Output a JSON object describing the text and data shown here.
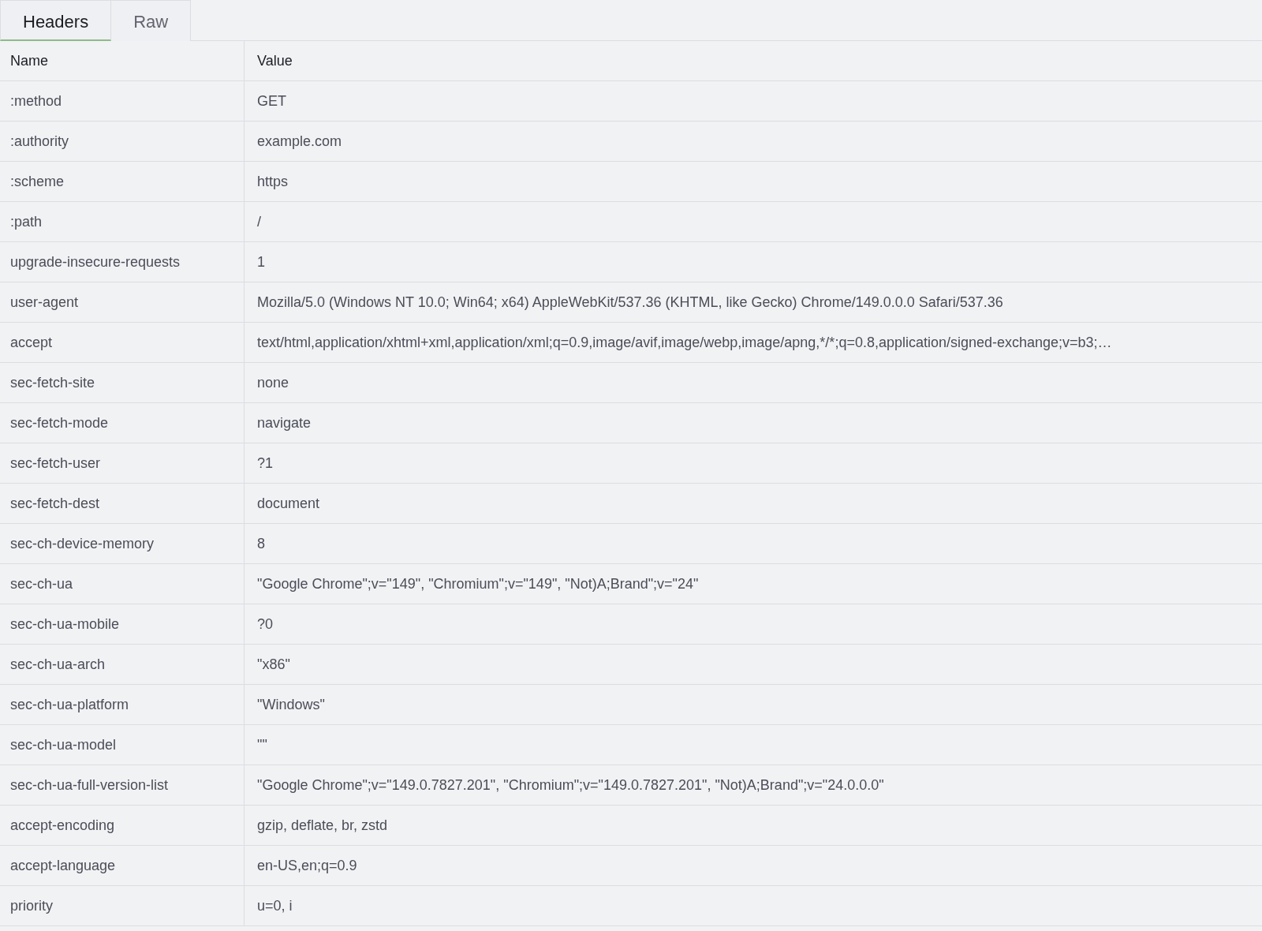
{
  "tabs": [
    {
      "label": "Headers",
      "selected": true
    },
    {
      "label": "Raw",
      "selected": false
    }
  ],
  "table": {
    "columns": [
      "Name",
      "Value"
    ],
    "rows": [
      {
        "name": ":method",
        "value": "GET"
      },
      {
        "name": ":authority",
        "value": "example.com"
      },
      {
        "name": ":scheme",
        "value": "https"
      },
      {
        "name": ":path",
        "value": "/"
      },
      {
        "name": "upgrade-insecure-requests",
        "value": "1"
      },
      {
        "name": "user-agent",
        "value": "Mozilla/5.0 (Windows NT 10.0; Win64; x64) AppleWebKit/537.36 (KHTML, like Gecko) Chrome/149.0.0.0 Safari/537.36"
      },
      {
        "name": "accept",
        "value": "text/html,application/xhtml+xml,application/xml;q=0.9,image/avif,image/webp,image/apng,*/*;q=0.8,application/signed-exchange;v=b3;…"
      },
      {
        "name": "sec-fetch-site",
        "value": "none"
      },
      {
        "name": "sec-fetch-mode",
        "value": "navigate"
      },
      {
        "name": "sec-fetch-user",
        "value": "?1"
      },
      {
        "name": "sec-fetch-dest",
        "value": "document"
      },
      {
        "name": "sec-ch-device-memory",
        "value": "8"
      },
      {
        "name": "sec-ch-ua",
        "value": "\"Google Chrome\";v=\"149\", \"Chromium\";v=\"149\", \"Not)A;Brand\";v=\"24\""
      },
      {
        "name": "sec-ch-ua-mobile",
        "value": "?0"
      },
      {
        "name": "sec-ch-ua-arch",
        "value": "\"x86\""
      },
      {
        "name": "sec-ch-ua-platform",
        "value": "\"Windows\""
      },
      {
        "name": "sec-ch-ua-model",
        "value": "\"\""
      },
      {
        "name": "sec-ch-ua-full-version-list",
        "value": "\"Google Chrome\";v=\"149.0.7827.201\", \"Chromium\";v=\"149.0.7827.201\", \"Not)A;Brand\";v=\"24.0.0.0\""
      },
      {
        "name": "accept-encoding",
        "value": "gzip, deflate, br, zstd"
      },
      {
        "name": "accept-language",
        "value": "en-US,en;q=0.9"
      },
      {
        "name": "priority",
        "value": "u=0, i"
      }
    ]
  }
}
